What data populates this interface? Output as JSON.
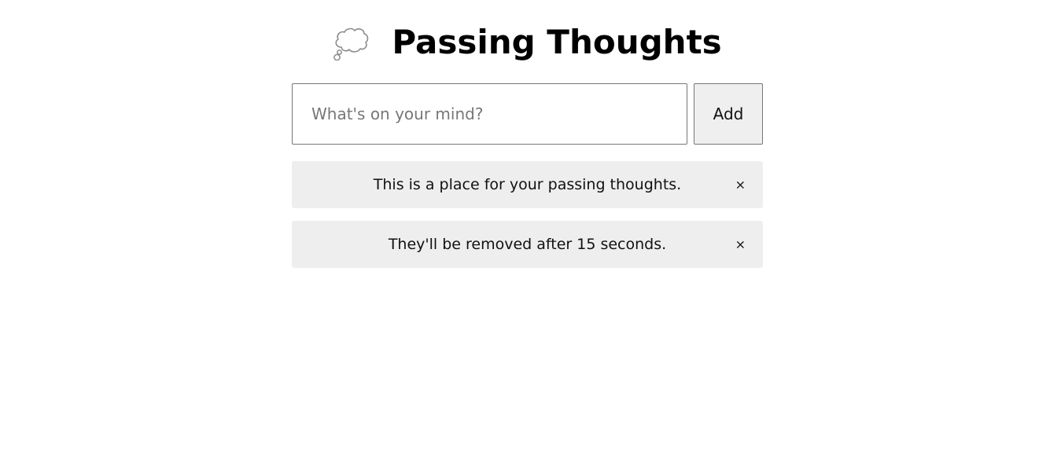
{
  "header": {
    "icon": "thought-cloud-icon",
    "title": "Passing Thoughts"
  },
  "composer": {
    "placeholder": "What's on your mind?",
    "value": "",
    "add_label": "Add"
  },
  "thoughts": [
    {
      "text": "This is a place for your passing thoughts.",
      "remove_label": "×"
    },
    {
      "text": "They'll be removed after 15 seconds.",
      "remove_label": "×"
    }
  ],
  "colors": {
    "thought_background": "#eeeeee",
    "button_background": "#efefef",
    "border": "#767676"
  }
}
